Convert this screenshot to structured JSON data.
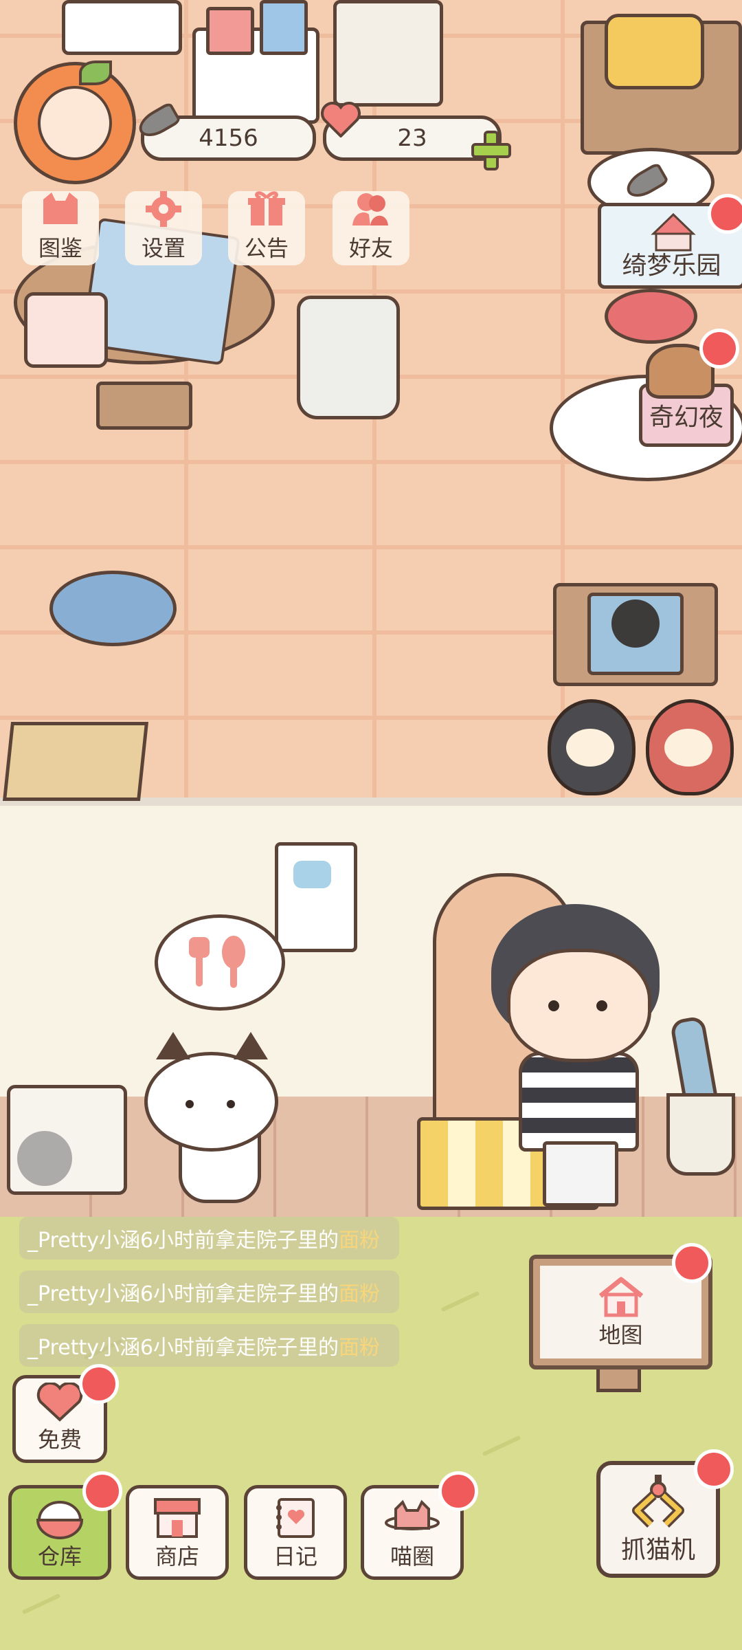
{
  "hud": {
    "fish_count": "4156",
    "heart_count": "23"
  },
  "menu": [
    {
      "label": "图鉴",
      "icon": "cat-book-icon"
    },
    {
      "label": "设置",
      "icon": "gear-icon"
    },
    {
      "label": "公告",
      "icon": "gift-icon"
    },
    {
      "label": "好友",
      "icon": "friends-icon"
    }
  ],
  "events": {
    "park_label": "绮梦乐园",
    "night_label": "奇幻夜"
  },
  "notices": [
    {
      "prefix": "_Pretty小涵6小时前拿走院子里的",
      "item": "面粉"
    },
    {
      "prefix": "_Pretty小涵6小时前拿走院子里的",
      "item": "面粉"
    },
    {
      "prefix": "_Pretty小涵6小时前拿走院子里的",
      "item": "面粉"
    }
  ],
  "bottom": {
    "free_label": "免费",
    "warehouse_label": "仓库",
    "shop_label": "商店",
    "diary_label": "日记",
    "meow_circle_label": "喵圈",
    "map_label": "地图",
    "claw_label": "抓猫机"
  },
  "colors": {
    "brick": "#f5cdb0",
    "outline": "#5b4337",
    "badge": "#f15a5a",
    "active": "#b5d264",
    "yard": "#d9dd8f",
    "notice_highlight": "#f8d57a"
  }
}
